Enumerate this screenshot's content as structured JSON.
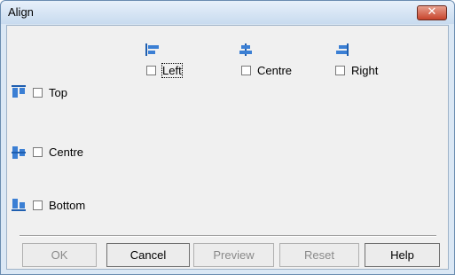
{
  "window": {
    "title": "Align"
  },
  "horizontal": [
    {
      "icon": "align-left-icon",
      "label": "Left",
      "checked": false
    },
    {
      "icon": "align-hcentre-icon",
      "label": "Centre",
      "checked": false
    },
    {
      "icon": "align-right-icon",
      "label": "Right",
      "checked": false
    }
  ],
  "vertical": [
    {
      "icon": "align-top-icon",
      "label": "Top",
      "checked": false
    },
    {
      "icon": "align-vcentre-icon",
      "label": "Centre",
      "checked": false
    },
    {
      "icon": "align-bottom-icon",
      "label": "Bottom",
      "checked": false
    }
  ],
  "buttons": {
    "ok": {
      "label": "OK",
      "enabled": false
    },
    "cancel": {
      "label": "Cancel",
      "enabled": true
    },
    "preview": {
      "label": "Preview",
      "enabled": false
    },
    "reset": {
      "label": "Reset",
      "enabled": false
    },
    "help": {
      "label": "Help",
      "enabled": true
    }
  },
  "colors": {
    "icon_blue": "#3b7fd4",
    "icon_dark": "#1f5fb0",
    "title_bar": "#c8dbef",
    "close": "#c7442c"
  }
}
